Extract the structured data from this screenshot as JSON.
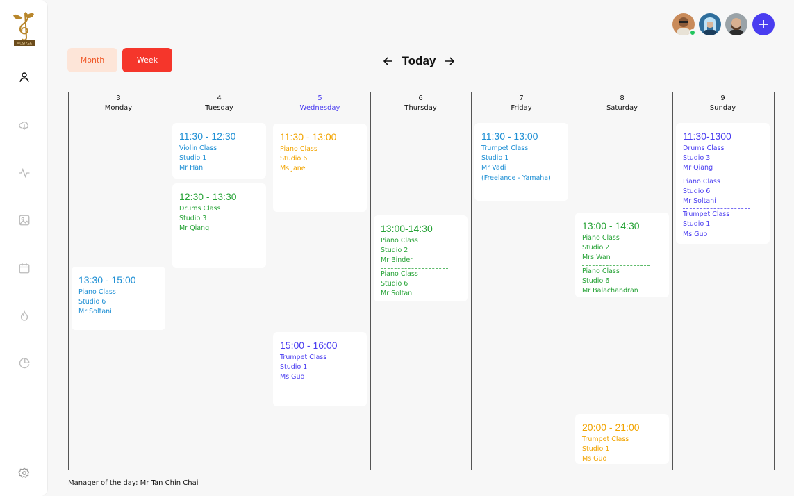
{
  "brand": {
    "logo_text": "MUSIKEE"
  },
  "sidebar": {
    "items": [
      {
        "icon": "user-icon"
      },
      {
        "icon": "download-icon"
      },
      {
        "icon": "activity-icon"
      },
      {
        "icon": "image-icon"
      },
      {
        "icon": "calendar-icon"
      },
      {
        "icon": "flame-icon"
      },
      {
        "icon": "pie-chart-icon"
      },
      {
        "icon": "settings-icon"
      }
    ]
  },
  "toolbar": {
    "month_label": "Month",
    "week_label": "Week",
    "today_label": "Today"
  },
  "days": [
    {
      "num": "3",
      "name": "Monday",
      "active": false
    },
    {
      "num": "4",
      "name": "Tuesday",
      "active": false
    },
    {
      "num": "5",
      "name": "Wednesday",
      "active": true
    },
    {
      "num": "6",
      "name": "Thursday",
      "active": false
    },
    {
      "num": "7",
      "name": "Friday",
      "active": false
    },
    {
      "num": "8",
      "name": "Saturday",
      "active": false
    },
    {
      "num": "9",
      "name": "Sunday",
      "active": false
    }
  ],
  "events": {
    "mon": {
      "time": "13:30 - 15:00",
      "lines": [
        "Piano Class",
        "Studio 6",
        "Mr Soltani"
      ]
    },
    "tue1": {
      "time": "11:30 - 12:30",
      "lines": [
        "Violin Class",
        "Studio 1",
        "Mr Han"
      ]
    },
    "tue2": {
      "time": "12:30 - 13:30",
      "lines": [
        "Drums Class",
        "Studio 3",
        "Mr Qiang"
      ]
    },
    "wed1": {
      "time": "11:30 - 13:00",
      "lines": [
        "Piano Class",
        "Studio 6",
        "Ms Jane"
      ]
    },
    "wed2": {
      "time": "15:00 - 16:00",
      "lines": [
        "Trumpet Class",
        "Studio 1",
        "Ms Guo"
      ]
    },
    "thu": {
      "time": "13:00-14:30",
      "lines": [
        "Piano Class",
        "Studio 2",
        "Mr Binder",
        "Piano Class",
        "Studio 6",
        "Mr Soltani"
      ]
    },
    "fri": {
      "time": "11:30 - 13:00",
      "lines": [
        "Trumpet Class",
        "Studio 1",
        "Mr Vadi",
        "(Freelance - Yamaha)"
      ]
    },
    "sat1": {
      "time": "13:00 - 14:30",
      "lines": [
        "Piano Class",
        "Studio 2",
        "Mrs Wan",
        "Piano Class",
        "Studio 6",
        "Mr Balachandran"
      ]
    },
    "sat2": {
      "time": "20:00 - 21:00",
      "lines": [
        "Trumpet Class",
        "Studio 1",
        "Ms Guo"
      ]
    },
    "sun": {
      "time": "11:30-1300",
      "lines": [
        "Drums Class",
        "Studio 3",
        "Mr Qiang",
        "Piano Class",
        "Studio 6",
        "Mr Soltani",
        "Trumpet Class",
        "Studio 1",
        "Ms Guo"
      ]
    }
  },
  "colors": {
    "accent": "#4a3df0",
    "week_button": "#f5362b",
    "month_button": "#fde5d8",
    "blue": "#1e8fd4",
    "green": "#27a337",
    "orange": "#f2a400",
    "purple": "#4a3df0",
    "online": "#22c55e"
  },
  "footer": {
    "manager_text": "Manager of the day: Mr Tan Chin Chai"
  }
}
